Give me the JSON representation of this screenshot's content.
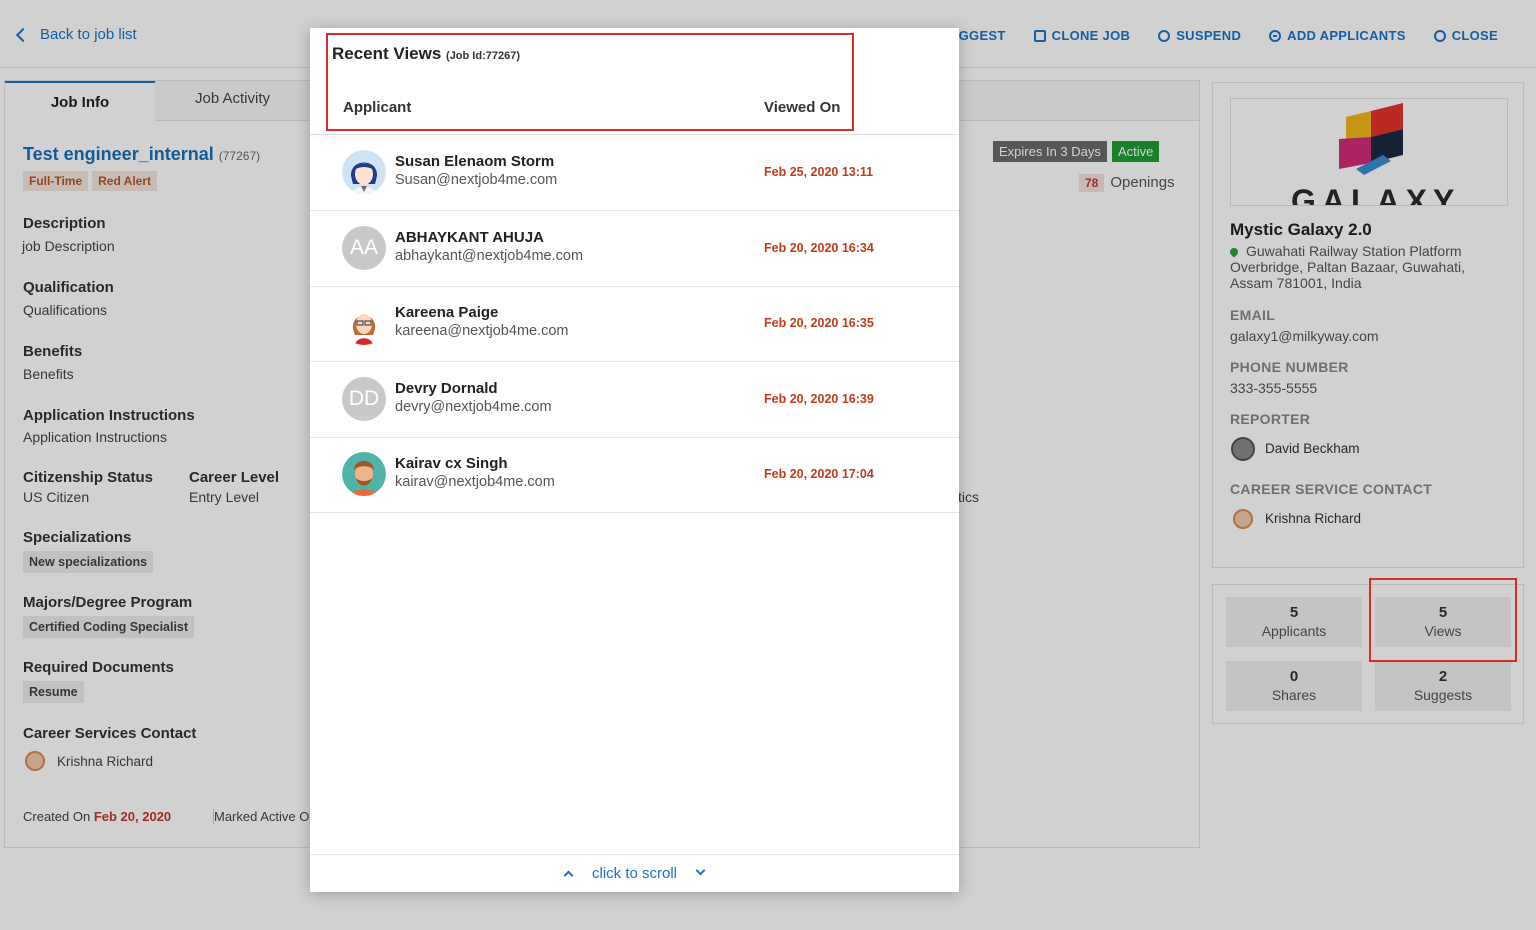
{
  "topbar": {
    "back_label": "Back to job list",
    "actions": [
      "UGGEST",
      "CLONE JOB",
      "SUSPEND",
      "ADD APPLICANTS",
      "CLOSE"
    ]
  },
  "tabs": {
    "job_info": "Job Info",
    "job_activity": "Job Activity"
  },
  "job": {
    "title": "Test engineer_internal",
    "id_label": "(77267)",
    "tags": [
      "Full-Time",
      "Red Alert"
    ],
    "expires": "Expires In 3 Days",
    "status": "Active",
    "openings_count": "78",
    "openings_label": "Openings",
    "tics_fragment": "tics"
  },
  "fields": {
    "description_label": "Description",
    "description_value": "job Description",
    "qualification_label": "Qualification",
    "qualification_value": "Qualifications",
    "benefits_label": "Benefits",
    "benefits_value": "Benefits",
    "instructions_label": "Application Instructions",
    "instructions_value": "Application Instructions",
    "citizenship_label": "Citizenship Status",
    "citizenship_value": "US Citizen",
    "career_level_label": "Career Level",
    "career_level_value": "Entry Level",
    "specializations_label": "Specializations",
    "specializations_value": "New specializations",
    "majors_label": "Majors/Degree Program",
    "majors_value": "Certified Coding Specialist",
    "documents_label": "Required Documents",
    "documents_value": "Resume",
    "career_contact_label": "Career Services Contact",
    "career_contact_value": "Krishna Richard",
    "created_label": "Created On",
    "created_value": "Feb 20, 2020",
    "marked_active_label": "Marked Active O"
  },
  "company": {
    "logo_text": "GALAXY",
    "name": "Mystic Galaxy 2.0",
    "address": "Guwahati Railway Station Platform Overbridge, Paltan Bazaar, Guwahati, Assam 781001, India",
    "email_label": "EMAIL",
    "email": "galaxy1@milkyway.com",
    "phone_label": "PHONE NUMBER",
    "phone": "333-355-5555",
    "reporter_label": "REPORTER",
    "reporter": "David Beckham",
    "career_label": "CAREER SERVICE CONTACT",
    "career_contact": "Krishna Richard"
  },
  "stats": [
    {
      "num": "5",
      "label": "Applicants"
    },
    {
      "num": "5",
      "label": "Views"
    },
    {
      "num": "0",
      "label": "Shares"
    },
    {
      "num": "2",
      "label": "Suggests"
    }
  ],
  "modal": {
    "title": "Recent Views",
    "job_id": "(Job Id:77267)",
    "col_applicant": "Applicant",
    "col_viewed_on": "Viewed On",
    "footer": "click to scroll",
    "rows": [
      {
        "name": "Susan Elenaom Storm",
        "email": "Susan@nextjob4me.com",
        "date": "Feb 25, 2020 13:11",
        "initials": ""
      },
      {
        "name": "ABHAYKANT AHUJA",
        "email": "abhaykant@nextjob4me.com",
        "date": "Feb 20, 2020 16:34",
        "initials": "AA"
      },
      {
        "name": "Kareena Paige",
        "email": "kareena@nextjob4me.com",
        "date": "Feb 20, 2020 16:35",
        "initials": ""
      },
      {
        "name": "Devry Dornald",
        "email": "devry@nextjob4me.com",
        "date": "Feb 20, 2020 16:39",
        "initials": "DD"
      },
      {
        "name": "Kairav cx Singh",
        "email": "kairav@nextjob4me.com",
        "date": "Feb 20, 2020 17:04",
        "initials": ""
      }
    ]
  },
  "colors": {
    "accent": "#1a73c8",
    "date_red": "#c23b1a",
    "highlight": "#d92b2b",
    "active_green": "#1e9e34"
  }
}
